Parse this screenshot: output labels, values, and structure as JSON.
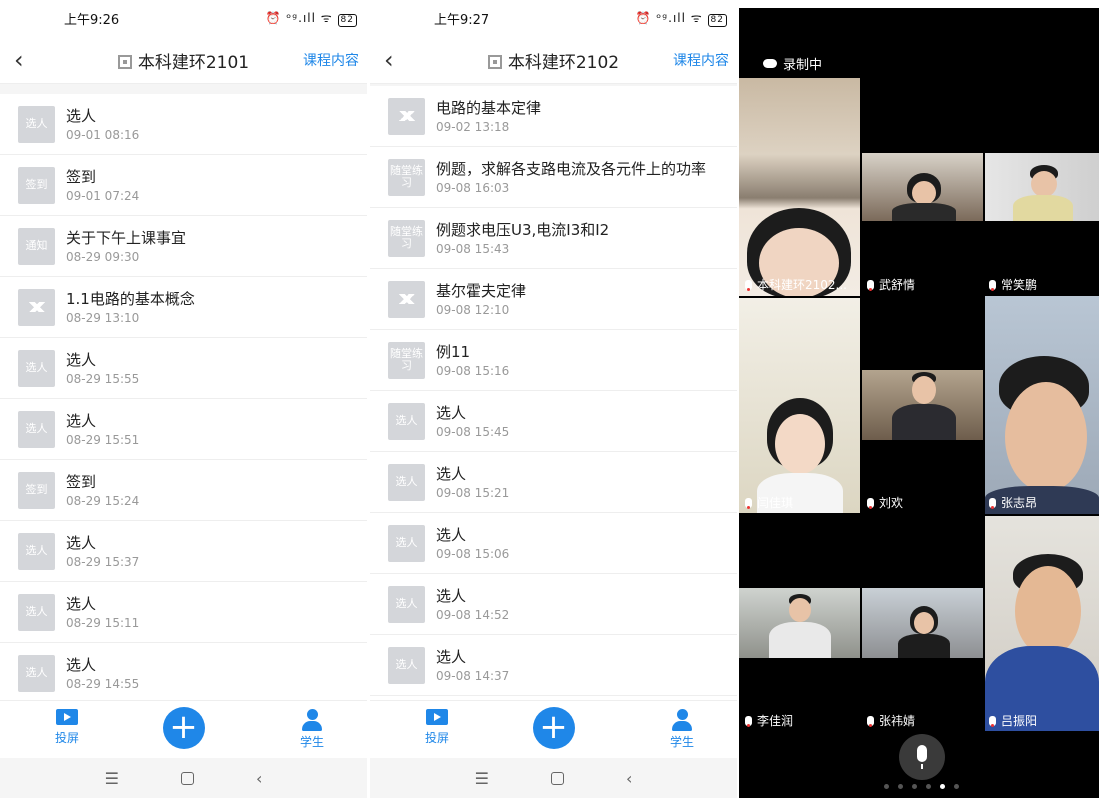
{
  "phone1": {
    "status_time": "上午9:26",
    "status_icons": "⏰ ᵒᵍ.ıll ᯤ",
    "battery": "82",
    "title": "本科建环2101",
    "course_link": "课程内容",
    "items": [
      {
        "badge": "选人",
        "title": "选人",
        "date": "09-01 08:16"
      },
      {
        "badge": "签到",
        "title": "签到",
        "date": "09-01 07:24"
      },
      {
        "badge": "通知",
        "title": "关于下午上课事宜",
        "date": "08-29 09:30"
      },
      {
        "badge": "",
        "title": "1.1电路的基本概念",
        "date": "08-29 13:10"
      },
      {
        "badge": "选人",
        "title": "选人",
        "date": "08-29 15:55"
      },
      {
        "badge": "选人",
        "title": "选人",
        "date": "08-29 15:51"
      },
      {
        "badge": "签到",
        "title": "签到",
        "date": "08-29 15:24"
      },
      {
        "badge": "选人",
        "title": "选人",
        "date": "08-29 15:37"
      },
      {
        "badge": "选人",
        "title": "选人",
        "date": "08-29 15:11"
      },
      {
        "badge": "选人",
        "title": "选人",
        "date": "08-29 14:55"
      }
    ],
    "tab_left": "投屏",
    "tab_right": "学生"
  },
  "phone2": {
    "status_time": "上午9:27",
    "status_icons": "⏰ ᵒᵍ.ıll ᯤ",
    "battery": "82",
    "title": "本科建环2102",
    "course_link": "课程内容",
    "items": [
      {
        "badge": "",
        "title": "电路的基本定律",
        "date": "09-02 13:18"
      },
      {
        "badge": "随堂练习",
        "title": "例题，求解各支路电流及各元件上的功率",
        "date": "09-08 16:03"
      },
      {
        "badge": "随堂练习",
        "title": "例题求电压U3,电流I3和I2",
        "date": "09-08 15:43"
      },
      {
        "badge": "",
        "title": "基尔霍夫定律",
        "date": "09-08 12:10"
      },
      {
        "badge": "随堂练习",
        "title": "例11",
        "date": "09-08 15:16"
      },
      {
        "badge": "选人",
        "title": "选人",
        "date": "09-08 15:45"
      },
      {
        "badge": "选人",
        "title": "选人",
        "date": "09-08 15:21"
      },
      {
        "badge": "选人",
        "title": "选人",
        "date": "09-08 15:06"
      },
      {
        "badge": "选人",
        "title": "选人",
        "date": "09-08 14:52"
      },
      {
        "badge": "选人",
        "title": "选人",
        "date": "09-08 14:37"
      }
    ],
    "tab_left": "投屏",
    "tab_right": "学生"
  },
  "video": {
    "recording": "录制中",
    "participants": [
      "本科建环2102...",
      "武舒情",
      "常笑鹏",
      "闫佳琪",
      "刘欢",
      "张志昂",
      "李佳润",
      "张祎婧",
      "吕振阳"
    ]
  },
  "colors": {
    "accent": "#1f87e8",
    "badge_bg": "#d4d6da"
  },
  "icons": [
    "back-arrow-icon",
    "qr-code-icon",
    "screen-cast-icon",
    "plus-icon",
    "student-icon",
    "microphone-icon",
    "cloud-icon"
  ]
}
